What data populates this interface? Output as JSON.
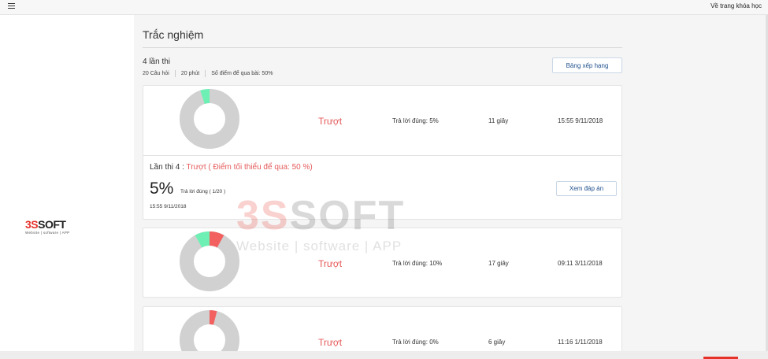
{
  "topbar": {
    "back_link": "Về trang khóa học"
  },
  "logo": {
    "main_red": "3S",
    "main_dark": "SOFT",
    "sub": "Website | software | APP"
  },
  "watermark": {
    "main_red": "3S",
    "main_dark": "SOFT",
    "sub": "Website | software | APP"
  },
  "quiz": {
    "title": "Trắc nghiệm",
    "attempts_label": "4 lần thi",
    "questions": "20 Câu hỏi",
    "duration": "20 phút",
    "pass_score": "Số điểm để qua bài: 50%",
    "ranking_button": "Bảng xếp hạng"
  },
  "colors": {
    "fail": "#e55a5a",
    "donut_bg": "#d1d1d1",
    "donut_wrong": "#f26060",
    "donut_correct": "#6ef0b4"
  },
  "attempts": [
    {
      "status": "Trượt",
      "correct_label": "Trả lời đúng: 5%",
      "time_spent": "11 giây",
      "datetime": "15:55 9/11/2018",
      "wrong_fraction": 0,
      "correct_fraction": 0.05,
      "expanded": true,
      "detail": {
        "heading_prefix": "Lần thi 4 :",
        "heading_status": "Trượt ( Điểm tối thiểu để qua: 50 %)",
        "percent": "5%",
        "ratio": "Trả lời đúng ( 1/20 )",
        "date": "15:55 9/11/2018",
        "answer_button": "Xem đáp án"
      }
    },
    {
      "status": "Trượt",
      "correct_label": "Trả lời đúng: 10%",
      "time_spent": "17 giây",
      "datetime": "09:11 3/11/2018",
      "wrong_fraction": 0.08,
      "correct_fraction": 0.08,
      "expanded": false
    },
    {
      "status": "Trượt",
      "correct_label": "Trả lời đúng: 0%",
      "time_spent": "6 giây",
      "datetime": "11:16 1/11/2018",
      "wrong_fraction": 0.04,
      "correct_fraction": 0,
      "expanded": false
    }
  ]
}
